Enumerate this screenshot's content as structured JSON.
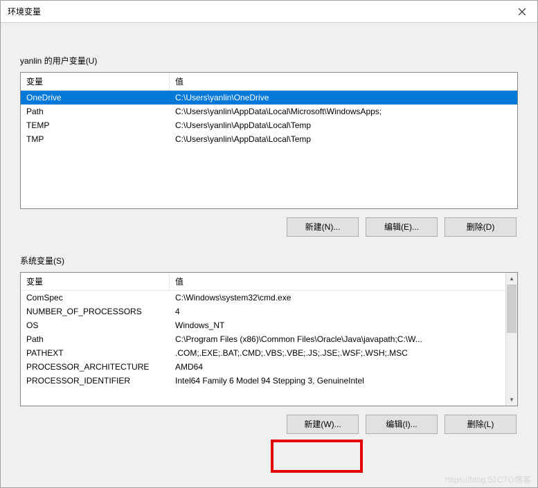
{
  "window": {
    "title": "环境变量"
  },
  "userSection": {
    "label": "yanlin 的用户变量(U)",
    "columns": {
      "var": "变量",
      "val": "值"
    },
    "rows": [
      {
        "var": "OneDrive",
        "val": "C:\\Users\\yanlin\\OneDrive"
      },
      {
        "var": "Path",
        "val": "C:\\Users\\yanlin\\AppData\\Local\\Microsoft\\WindowsApps;"
      },
      {
        "var": "TEMP",
        "val": "C:\\Users\\yanlin\\AppData\\Local\\Temp"
      },
      {
        "var": "TMP",
        "val": "C:\\Users\\yanlin\\AppData\\Local\\Temp"
      }
    ],
    "buttons": {
      "new": "新建(N)...",
      "edit": "编辑(E)...",
      "delete": "删除(D)"
    }
  },
  "systemSection": {
    "label": "系统变量(S)",
    "columns": {
      "var": "变量",
      "val": "值"
    },
    "rows": [
      {
        "var": "ComSpec",
        "val": "C:\\Windows\\system32\\cmd.exe"
      },
      {
        "var": "NUMBER_OF_PROCESSORS",
        "val": "4"
      },
      {
        "var": "OS",
        "val": "Windows_NT"
      },
      {
        "var": "Path",
        "val": "C:\\Program Files (x86)\\Common Files\\Oracle\\Java\\javapath;C:\\W..."
      },
      {
        "var": "PATHEXT",
        "val": ".COM;.EXE;.BAT;.CMD;.VBS;.VBE;.JS;.JSE;.WSF;.WSH;.MSC"
      },
      {
        "var": "PROCESSOR_ARCHITECTURE",
        "val": "AMD64"
      },
      {
        "var": "PROCESSOR_IDENTIFIER",
        "val": "Intel64 Family 6 Model 94 Stepping 3, GenuineIntel"
      }
    ],
    "buttons": {
      "new": "新建(W)...",
      "edit": "编辑(I)...",
      "delete": "删除(L)"
    }
  },
  "watermark": "https://blog.51CTO博客"
}
